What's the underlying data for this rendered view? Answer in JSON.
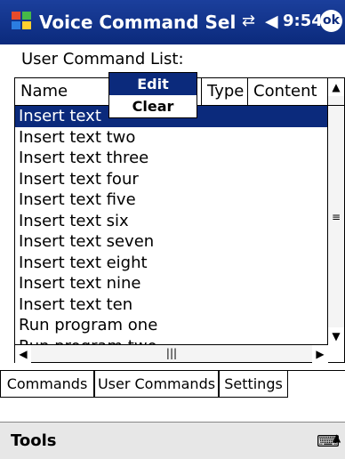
{
  "titlebar": {
    "title": "Voice Command Sel",
    "time": "9:54",
    "ok_label": "ok"
  },
  "list_label": "User Command List:",
  "columns": [
    "Name",
    "Type",
    "Content"
  ],
  "rows": [
    "Insert text",
    "Insert text two",
    "Insert text three",
    "Insert text four",
    "Insert text five",
    "Insert text six",
    "Insert text seven",
    "Insert text eight",
    "Insert text nine",
    "Insert text ten",
    "Run program one",
    "Run program two"
  ],
  "context_menu": {
    "edit": "Edit",
    "clear": "Clear"
  },
  "tabs": [
    "Commands",
    "User Commands",
    "Settings"
  ],
  "command_bar": {
    "tools": "Tools"
  }
}
